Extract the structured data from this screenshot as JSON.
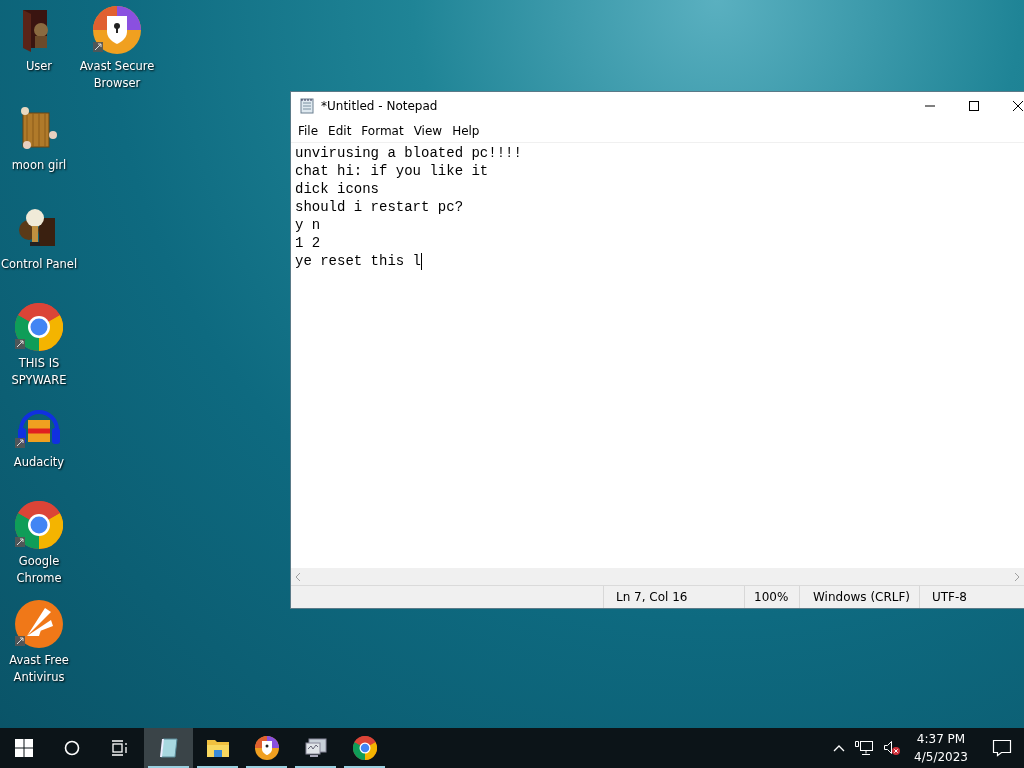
{
  "desktop_icons": [
    {
      "label": "User",
      "kind": "folder"
    },
    {
      "label": "moon girl",
      "kind": "box"
    },
    {
      "label": "Control Panel",
      "kind": "bulb"
    },
    {
      "label": "THIS IS SPYWARE",
      "kind": "chrome"
    },
    {
      "label": "Audacity",
      "kind": "audacity"
    },
    {
      "label": "Google Chrome",
      "kind": "chrome"
    },
    {
      "label": "Avast Free Antivirus",
      "kind": "avast"
    },
    {
      "label": "Avast Secure Browser",
      "kind": "secure"
    }
  ],
  "notepad": {
    "title": "*Untitled - Notepad",
    "menu": [
      "File",
      "Edit",
      "Format",
      "View",
      "Help"
    ],
    "lines": [
      "unvirusing a bloated pc!!!!",
      "chat hi: if you like it",
      "dick icons",
      "should i restart pc?",
      "y n",
      "1 2",
      "ye reset this l"
    ],
    "status_bar": [
      "Ln 7, Col 16",
      "100%",
      "Windows (CRLF)",
      "UTF-8"
    ]
  },
  "taskbar": {
    "apps": [
      {
        "kind": "notepad",
        "selected": true,
        "running": true
      },
      {
        "kind": "explorer",
        "selected": false,
        "running": true
      },
      {
        "kind": "secure",
        "selected": false,
        "running": true
      },
      {
        "kind": "monitor",
        "selected": false,
        "running": true
      },
      {
        "kind": "chrome",
        "selected": false,
        "running": true
      }
    ],
    "time": "4:37 PM",
    "date": "4/5/2023"
  }
}
